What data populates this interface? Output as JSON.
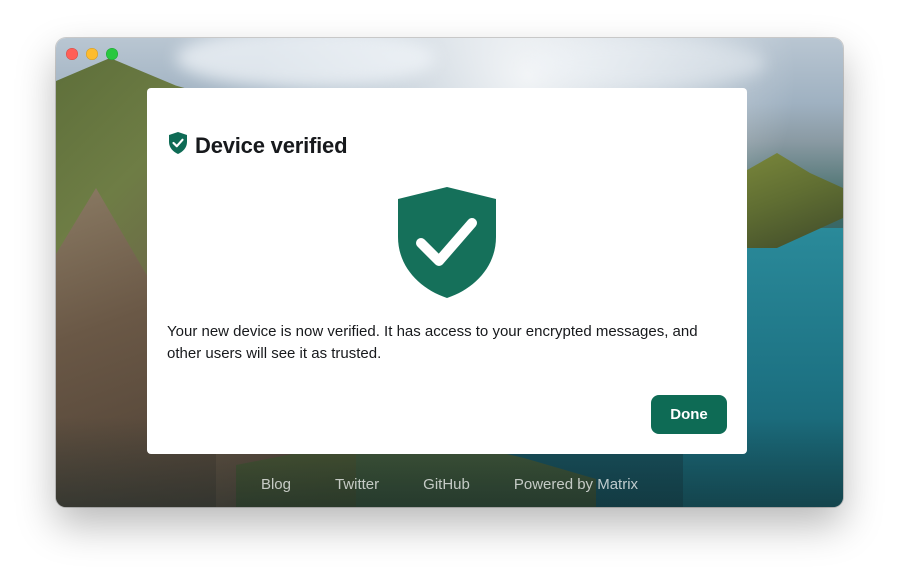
{
  "window": {
    "traffic_lights": [
      "close",
      "minimize",
      "maximize"
    ]
  },
  "dialog": {
    "title": "Device verified",
    "title_icon": "shield-check-icon",
    "illustration_icon": "shield-check-icon",
    "body": "Your new device is now verified. It has access to your encrypted messages, and other users will see it as trusted.",
    "done_label": "Done"
  },
  "footer": {
    "links": [
      {
        "label": "Blog"
      },
      {
        "label": "Twitter"
      },
      {
        "label": "GitHub"
      },
      {
        "label": "Powered by Matrix"
      }
    ]
  },
  "colors": {
    "accent": "#0e6b55",
    "title_text": "#17191c",
    "footer_text": "#ffffff"
  }
}
